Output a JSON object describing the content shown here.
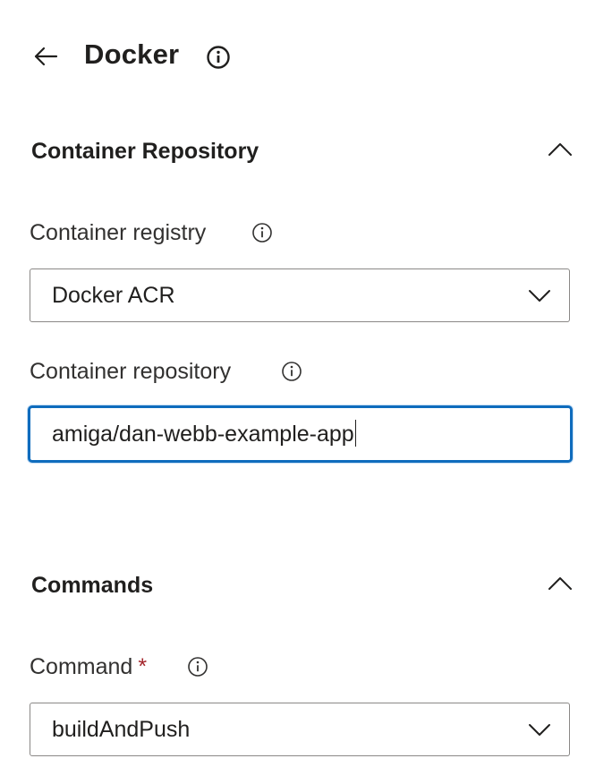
{
  "header": {
    "title": "Docker",
    "back_icon": "arrow-left-icon",
    "info_icon": "info-icon"
  },
  "sections": {
    "container_repository": {
      "title": "Container Repository",
      "expanded": true,
      "fields": {
        "registry": {
          "label": "Container registry",
          "value": "Docker ACR"
        },
        "repository": {
          "label": "Container repository",
          "value": "amiga/dan-webb-example-app",
          "focused": true
        }
      }
    },
    "commands": {
      "title": "Commands",
      "expanded": true,
      "fields": {
        "command": {
          "label": "Command",
          "required_marker": "*",
          "value": "buildAndPush"
        }
      }
    }
  },
  "colors": {
    "text": "#201f1e",
    "focus_border": "#0f6cbd",
    "input_border": "#8a8886",
    "required": "#a4262c"
  }
}
